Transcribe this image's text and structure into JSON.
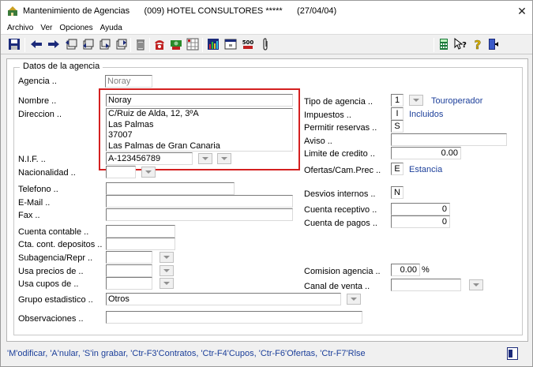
{
  "window": {
    "title": "Mantenimiento de Agencias      (009) HOTEL CONSULTORES *****      (27/04/04)",
    "close_glyph": "✕"
  },
  "menu": [
    "Archivo",
    "Ver",
    "Opciones",
    "Ayuda"
  ],
  "toolbar_icons": [
    "save-icon",
    "back-arrow-icon",
    "forward-arrow-icon",
    "record-first-icon",
    "record-prev-icon",
    "record-next-icon",
    "record-last-icon",
    "trash-icon",
    "phone-icon",
    "money-icon",
    "grid-icon",
    "chart-icon",
    "window-icon",
    "grid-500-icon",
    "paperclip-icon",
    "calculator-icon",
    "help-cursor-icon",
    "question-icon",
    "exit-door-icon"
  ],
  "toolbar_text": {
    "grid500": "500"
  },
  "group": {
    "title": "Datos de la agencia"
  },
  "form": {
    "agencia": {
      "label": "Agencia ..",
      "value": "Noray"
    },
    "nombre": {
      "label": "Nombre ..",
      "value": "Noray"
    },
    "direccion": {
      "label": "Direccion ..",
      "lines": [
        "C/Ruiz de Alda, 12, 3ºA",
        "Las Palmas",
        "37007",
        "Las Palmas de Gran Canaria"
      ]
    },
    "nif": {
      "label": "N.I.F. ..",
      "value": "A-123456789"
    },
    "nacionalidad": {
      "label": "Nacionalidad ..",
      "value": ""
    },
    "telefono": {
      "label": "Telefono ..",
      "value": ""
    },
    "email": {
      "label": "E-Mail ..",
      "value": ""
    },
    "fax": {
      "label": "Fax ..",
      "value": ""
    },
    "cuenta_contable": {
      "label": "Cuenta contable ..",
      "value": ""
    },
    "cta_depositos": {
      "label": "Cta. cont. depositos ..",
      "value": ""
    },
    "subagencia": {
      "label": "Subagencia/Repr ..",
      "value": ""
    },
    "usa_precios": {
      "label": "Usa precios de ..",
      "value": ""
    },
    "usa_cupos": {
      "label": "Usa cupos de ..",
      "value": ""
    },
    "grupo_estadistico": {
      "label": "Grupo estadistico ..",
      "value": "Otros"
    },
    "observaciones": {
      "label": "Observaciones ..",
      "value": ""
    },
    "tipo_agencia": {
      "label": "Tipo de agencia ..",
      "code": "1",
      "description": "Touroperador"
    },
    "impuestos": {
      "label": "Impuestos ..",
      "code": "I",
      "description": "Incluidos"
    },
    "permitir_reservas": {
      "label": "Permitir reservas ..",
      "code": "S"
    },
    "aviso": {
      "label": "Aviso ..",
      "value": ""
    },
    "limite_credito": {
      "label": "Limite de credito ..",
      "value": "0.00"
    },
    "ofertas": {
      "label": "Ofertas/Cam.Prec ..",
      "code": "E",
      "description": "Estancia"
    },
    "desvios_internos": {
      "label": "Desvios internos ..",
      "code": "N"
    },
    "cuenta_receptivo": {
      "label": "Cuenta receptivo ..",
      "value": "0"
    },
    "cuenta_pagos": {
      "label": "Cuenta de pagos ..",
      "value": "0"
    },
    "comision_agencia": {
      "label": "Comision agencia ..",
      "value": "0.00",
      "unit": "%"
    },
    "canal_venta": {
      "label": "Canal de venta ..",
      "value": ""
    }
  },
  "status_text": "'M'odificar, 'A'nular, 'S'in grabar, 'Ctr-F3'Contratos, 'Ctr-F4'Cupos, 'Ctr-F6'Ofertas, 'Ctr-F7'Rlse",
  "colors": {
    "highlight": "#d42020",
    "link_blue": "#1c3f9a"
  }
}
